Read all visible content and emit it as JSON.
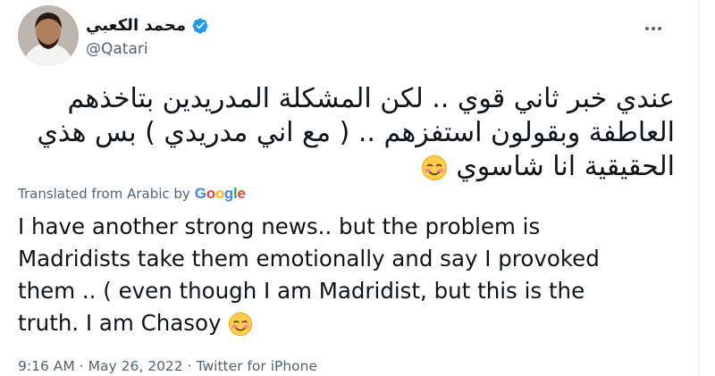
{
  "author": {
    "display_name": "محمد الكعبي",
    "handle": "@Qatari",
    "verified": true
  },
  "tweet": {
    "original_lines": [
      "عندي خبر ثاني قوي .. لكن المشكلة المدريدين بتاخذهم",
      "العاطفة وبقولون استفزهم .. ( مع اني مدريدي ) بس هذي",
      "الحقيقية انا شاسوي"
    ],
    "translated_label": "Translated from Arabic by",
    "translator": "Google",
    "translation_lines": [
      "I have another strong news.. but the problem is",
      "Madridists take them emotionally and say I provoked",
      "them .. ( even though I am Madridist, but this is the",
      "truth. I am Chasoy"
    ],
    "emoji": "smiling-face-with-smiling-eyes"
  },
  "meta": {
    "time": "9:16 AM",
    "separator": "·",
    "date": "May 26, 2022",
    "source": "Twitter for iPhone"
  },
  "colors": {
    "text": "#0f1419",
    "secondary": "#536471",
    "verified": "#1d9bf0",
    "google_blue": "#4285f4",
    "google_red": "#ea4335",
    "google_yellow": "#fbbc05",
    "google_green": "#34a853"
  }
}
